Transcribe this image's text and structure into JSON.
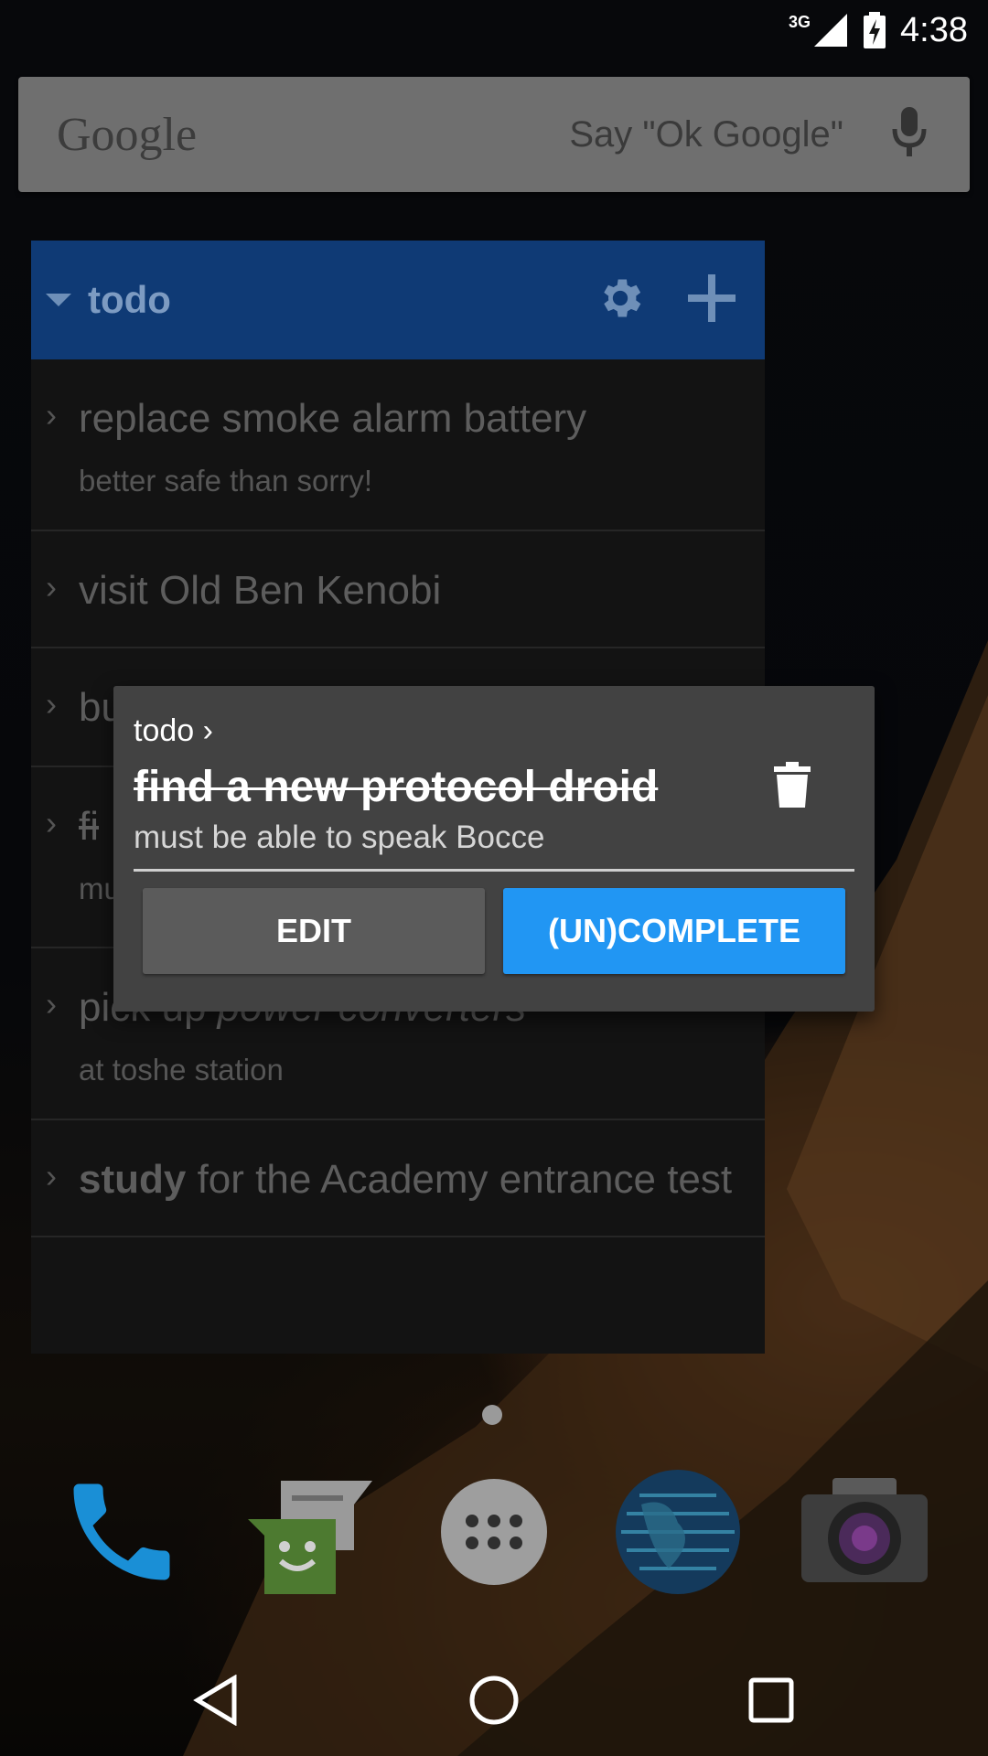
{
  "status_bar": {
    "network": "3G",
    "time": "4:38"
  },
  "search": {
    "logo": "Google",
    "hint": "Say \"Ok Google\""
  },
  "widget": {
    "title": "todo",
    "items": [
      {
        "title": "replace smoke alarm battery",
        "subtitle": "better safe than sorry!"
      },
      {
        "title": "visit Old Ben Kenobi",
        "subtitle": ""
      },
      {
        "title": "bu",
        "subtitle": ""
      },
      {
        "title": "fi",
        "subtitle": "mu"
      },
      {
        "title_prefix": "pick up ",
        "title_em": "power converters",
        "subtitle": "at toshe station"
      },
      {
        "title_bold": "study",
        "title_rest": " for the Academy entrance test",
        "subtitle": ""
      }
    ]
  },
  "dialog": {
    "breadcrumb": "todo ›",
    "title": "find a new protocol droid",
    "note": "must be able to speak Bocce",
    "edit_label": "EDIT",
    "complete_label": "(UN)COMPLETE"
  },
  "dock": {
    "apps": [
      "phone-icon",
      "messenger-icon",
      "app-drawer-icon",
      "browser-globe-icon",
      "camera-icon"
    ]
  },
  "colors": {
    "widget_header": "#0f3a75",
    "complete_button": "#2196f3",
    "dialog_bg": "#424242"
  }
}
